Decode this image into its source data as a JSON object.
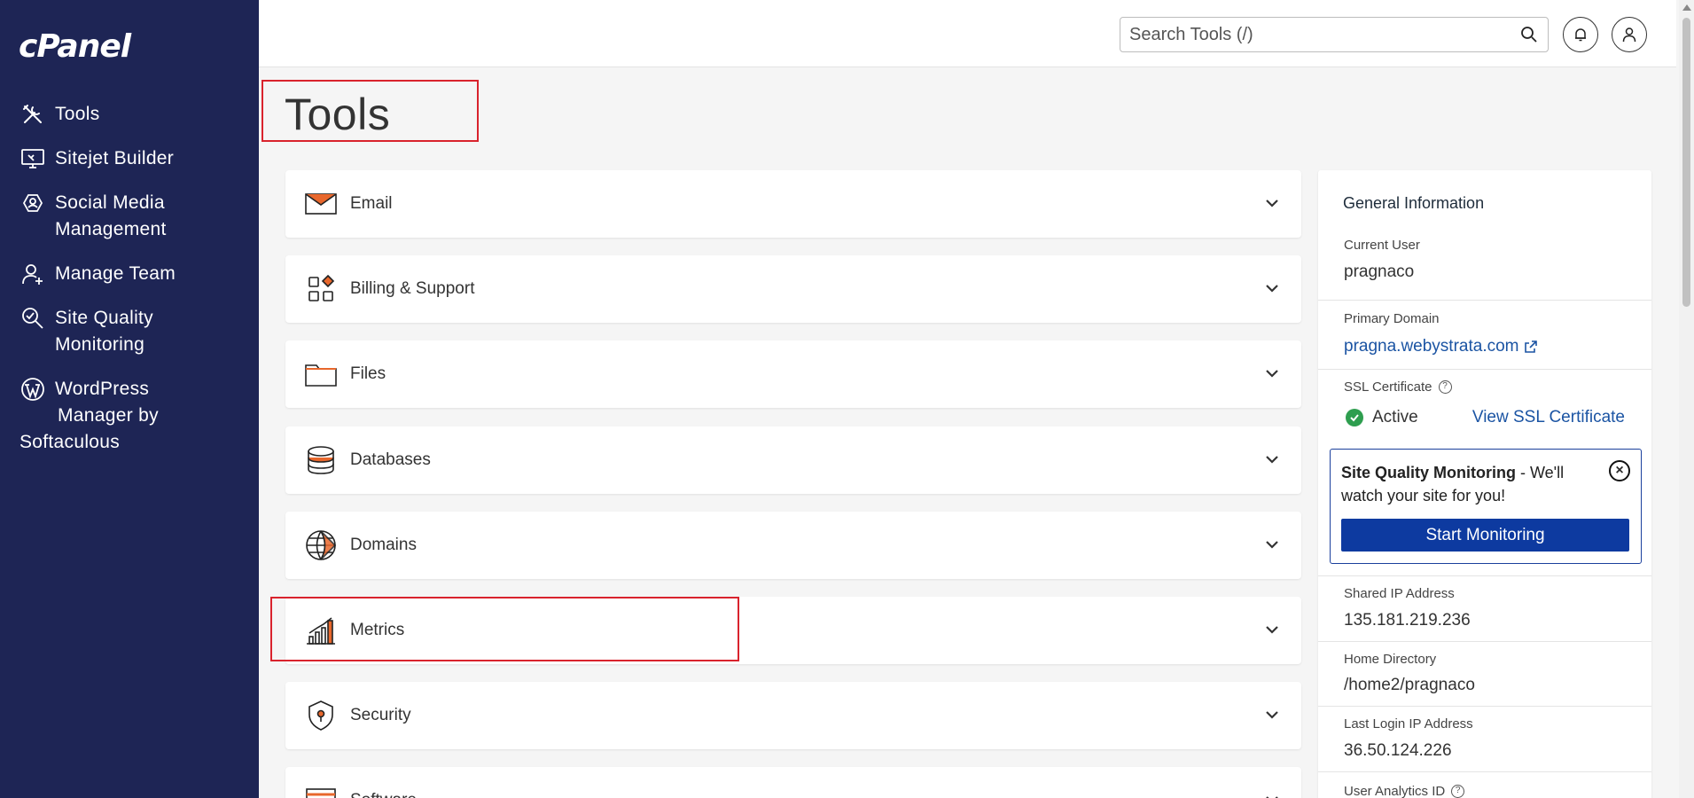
{
  "app": {
    "logo": "cPanel"
  },
  "sidebar": {
    "items": [
      {
        "label": "Tools",
        "icon": "tools-icon"
      },
      {
        "label": "Sitejet Builder",
        "icon": "sitejet-icon"
      },
      {
        "label": "Social Media",
        "label2": "Management",
        "icon": "social-media-icon"
      },
      {
        "label": "Manage Team",
        "icon": "manage-team-icon"
      },
      {
        "label": "Site Quality",
        "label2": "Monitoring",
        "icon": "site-quality-icon"
      },
      {
        "label": "WordPress",
        "label2": "Manager by",
        "label3": "Softaculous",
        "icon": "wordpress-icon"
      }
    ]
  },
  "header": {
    "search_placeholder": "Search Tools (/)"
  },
  "page": {
    "title": "Tools"
  },
  "panels": [
    {
      "label": "Email",
      "icon": "email-icon"
    },
    {
      "label": "Billing & Support",
      "icon": "billing-icon"
    },
    {
      "label": "Files",
      "icon": "folder-icon"
    },
    {
      "label": "Databases",
      "icon": "database-icon"
    },
    {
      "label": "Domains",
      "icon": "globe-icon"
    },
    {
      "label": "Metrics",
      "icon": "metrics-icon"
    },
    {
      "label": "Security",
      "icon": "shield-icon"
    },
    {
      "label": "Software",
      "icon": "software-icon"
    }
  ],
  "info": {
    "title": "General Information",
    "current_user_label": "Current User",
    "current_user": "pragnaco",
    "primary_domain_label": "Primary Domain",
    "primary_domain": "pragna.webystrata.com",
    "ssl_label": "SSL Certificate",
    "ssl_status": "Active",
    "ssl_link": "View SSL Certificate",
    "sqm_title": "Site Quality Monitoring",
    "sqm_text": " - We'll watch your site for you!",
    "sqm_button": "Start Monitoring",
    "shared_ip_label": "Shared IP Address",
    "shared_ip": "135.181.219.236",
    "home_dir_label": "Home Directory",
    "home_dir": "/home2/pragnaco",
    "last_login_label": "Last Login IP Address",
    "last_login": "36.50.124.226",
    "analytics_label": "User Analytics ID"
  },
  "colors": {
    "sidebar_bg": "#1e2555",
    "accent_orange": "#e8672c",
    "button_blue": "#0d3aa0",
    "link_blue": "#1b54a3",
    "highlight_red": "#d9232d",
    "ok_green": "#2e9e4f"
  }
}
